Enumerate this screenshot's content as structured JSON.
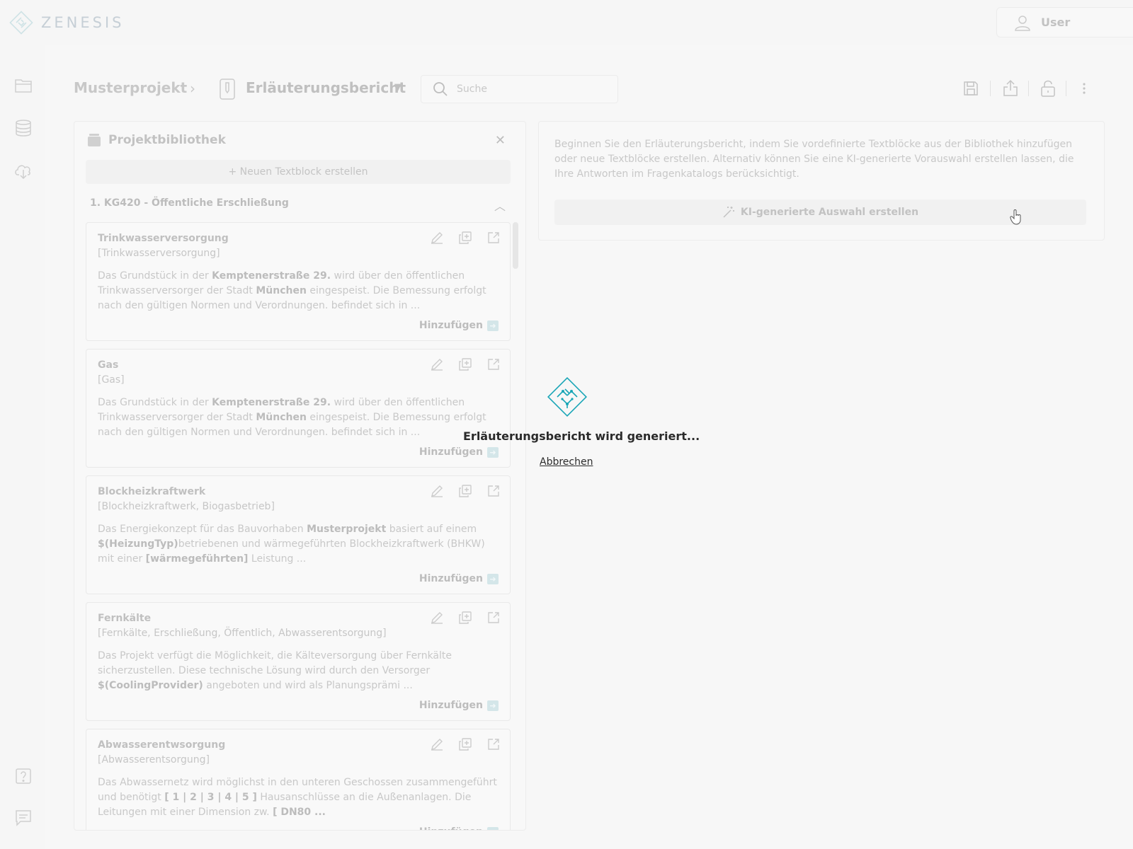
{
  "app": {
    "logo_text": "ZENESIS"
  },
  "user": {
    "label": "User"
  },
  "breadcrumb": {
    "project": "Musterprojekt",
    "document": "Erläuterungsbericht"
  },
  "search": {
    "placeholder": "Suche"
  },
  "library": {
    "title": "Projektbibliothek",
    "new_block_label": "+ Neuen Textblock erstellen",
    "section_title": "1. KG420 - Öffentliche Erschließung",
    "add_label": "Hinzufügen",
    "cards": [
      {
        "title": "Trinkwasserversorgung",
        "tags": "[Trinkwasserversorgung]",
        "body": [
          {
            "t": "Das Grundstück in der "
          },
          {
            "b": "Kemptenerstraße 29."
          },
          {
            "t": " wird über den öffentlichen Trinkwasserversorger der Stadt "
          },
          {
            "b": "München"
          },
          {
            "t": " eingespeist. Die Bemessung erfolgt nach den gültigen Normen und Verordnungen. befindet sich in ..."
          }
        ]
      },
      {
        "title": "Gas",
        "tags": "[Gas]",
        "body": [
          {
            "t": "Das Grundstück in der "
          },
          {
            "b": "Kemptenerstraße 29."
          },
          {
            "t": " wird über den öffentlichen Trinkwasserversorger der Stadt "
          },
          {
            "b": "München"
          },
          {
            "t": " eingespeist. Die Bemessung erfolgt nach den gültigen Normen und Verordnungen. befindet sich in ..."
          }
        ]
      },
      {
        "title": "Blockheizkraftwerk",
        "tags": "[Blockheizkraftwerk, Biogasbetrieb]",
        "body": [
          {
            "t": "Das Energiekonzept für das Bauvorhaben "
          },
          {
            "b": "Musterprojekt"
          },
          {
            "t": " basiert auf einem "
          },
          {
            "b": "$(HeizungTyp)"
          },
          {
            "t": "betriebenen und wärmegeführten Blockheizkraftwerk (BHKW) mit einer "
          },
          {
            "b": "[wärmegeführten]"
          },
          {
            "t": " Leistung  ..."
          }
        ]
      },
      {
        "title": "Fernkälte",
        "tags": "[Fernkälte, Erschließung, Öffentlich, Abwasserentsorgung]",
        "body": [
          {
            "t": "Das Projekt verfügt die Möglichkeit, die Kälteversorgung über Fernkälte sicherzustellen. Diese technische Lösung wird durch den Versorger "
          },
          {
            "b": "$(CoolingProvider)"
          },
          {
            "t": " angeboten und wird als Planungsprämi ..."
          }
        ]
      },
      {
        "title": "Abwasserentwsorgung",
        "tags": "[Abwasserentsorgung]",
        "body": [
          {
            "t": "Das Abwassernetz wird möglichst in den unteren Geschossen zusammengeführt und benötigt "
          },
          {
            "b": "[ 1 | 2 | 3 | 4 | 5 ]"
          },
          {
            "t": " Hausanschlüsse an die Außenanlagen. Die Leitungen mit einer Dimension zw. "
          },
          {
            "b": "[ DN80 ..."
          }
        ]
      }
    ]
  },
  "editor": {
    "intro": "Beginnen Sie den Erläuterungsbericht, indem Sie vordefinierte Textblöcke aus der Bibliothek hinzufügen oder neue Textblöcke erstellen. Alternativ können Sie eine KI-generierte Vorauswahl erstellen lassen, die Ihre Antworten im Fragenkatalogs berücksichtigt.",
    "ki_button": "KI-generierte Auswahl erstellen"
  },
  "loading": {
    "message": "Erläuterungsbericht wird generiert...",
    "cancel_label": "Abbrechen"
  },
  "colors": {
    "accent": "#1aa6b7",
    "muted": "#c8c8c8"
  }
}
